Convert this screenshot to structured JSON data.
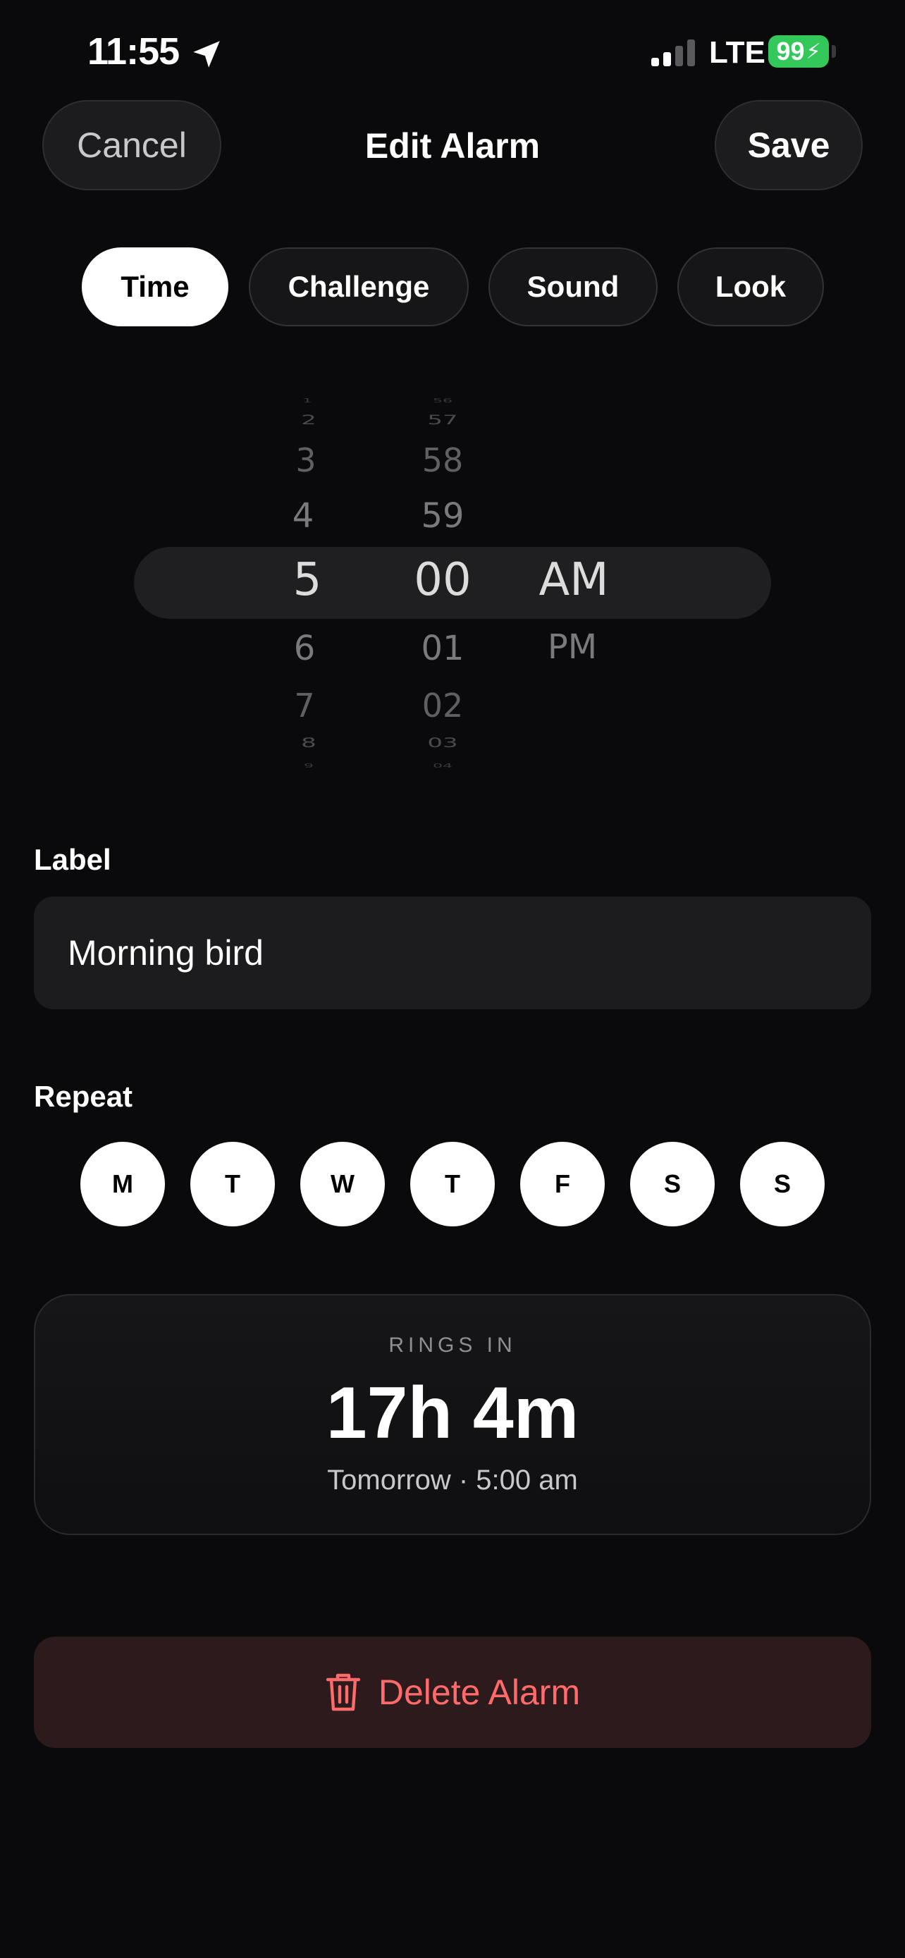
{
  "status_bar": {
    "time": "11:55",
    "network": "LTE",
    "battery": "99"
  },
  "nav": {
    "cancel": "Cancel",
    "title": "Edit Alarm",
    "save": "Save"
  },
  "tabs": [
    {
      "label": "Time",
      "active": true
    },
    {
      "label": "Challenge",
      "active": false
    },
    {
      "label": "Sound",
      "active": false
    },
    {
      "label": "Look",
      "active": false
    }
  ],
  "picker": {
    "hours": [
      "1",
      "2",
      "3",
      "4",
      "5",
      "6",
      "7",
      "8",
      "9"
    ],
    "minutes": [
      "56",
      "57",
      "58",
      "59",
      "00",
      "01",
      "02",
      "03",
      "04"
    ],
    "periods": [
      "AM",
      "PM"
    ],
    "selected": {
      "hour": "5",
      "minute": "00",
      "period": "AM"
    }
  },
  "label_section": {
    "heading": "Label",
    "value": "Morning bird"
  },
  "repeat_section": {
    "heading": "Repeat",
    "days": [
      "M",
      "T",
      "W",
      "T",
      "F",
      "S",
      "S"
    ]
  },
  "rings": {
    "label": "RINGS IN",
    "value": "17h 4m",
    "sub": "Tomorrow · 5:00 am"
  },
  "delete": {
    "label": "Delete Alarm"
  },
  "colors": {
    "accent_delete": "#ff6a6a",
    "battery": "#34c759"
  }
}
